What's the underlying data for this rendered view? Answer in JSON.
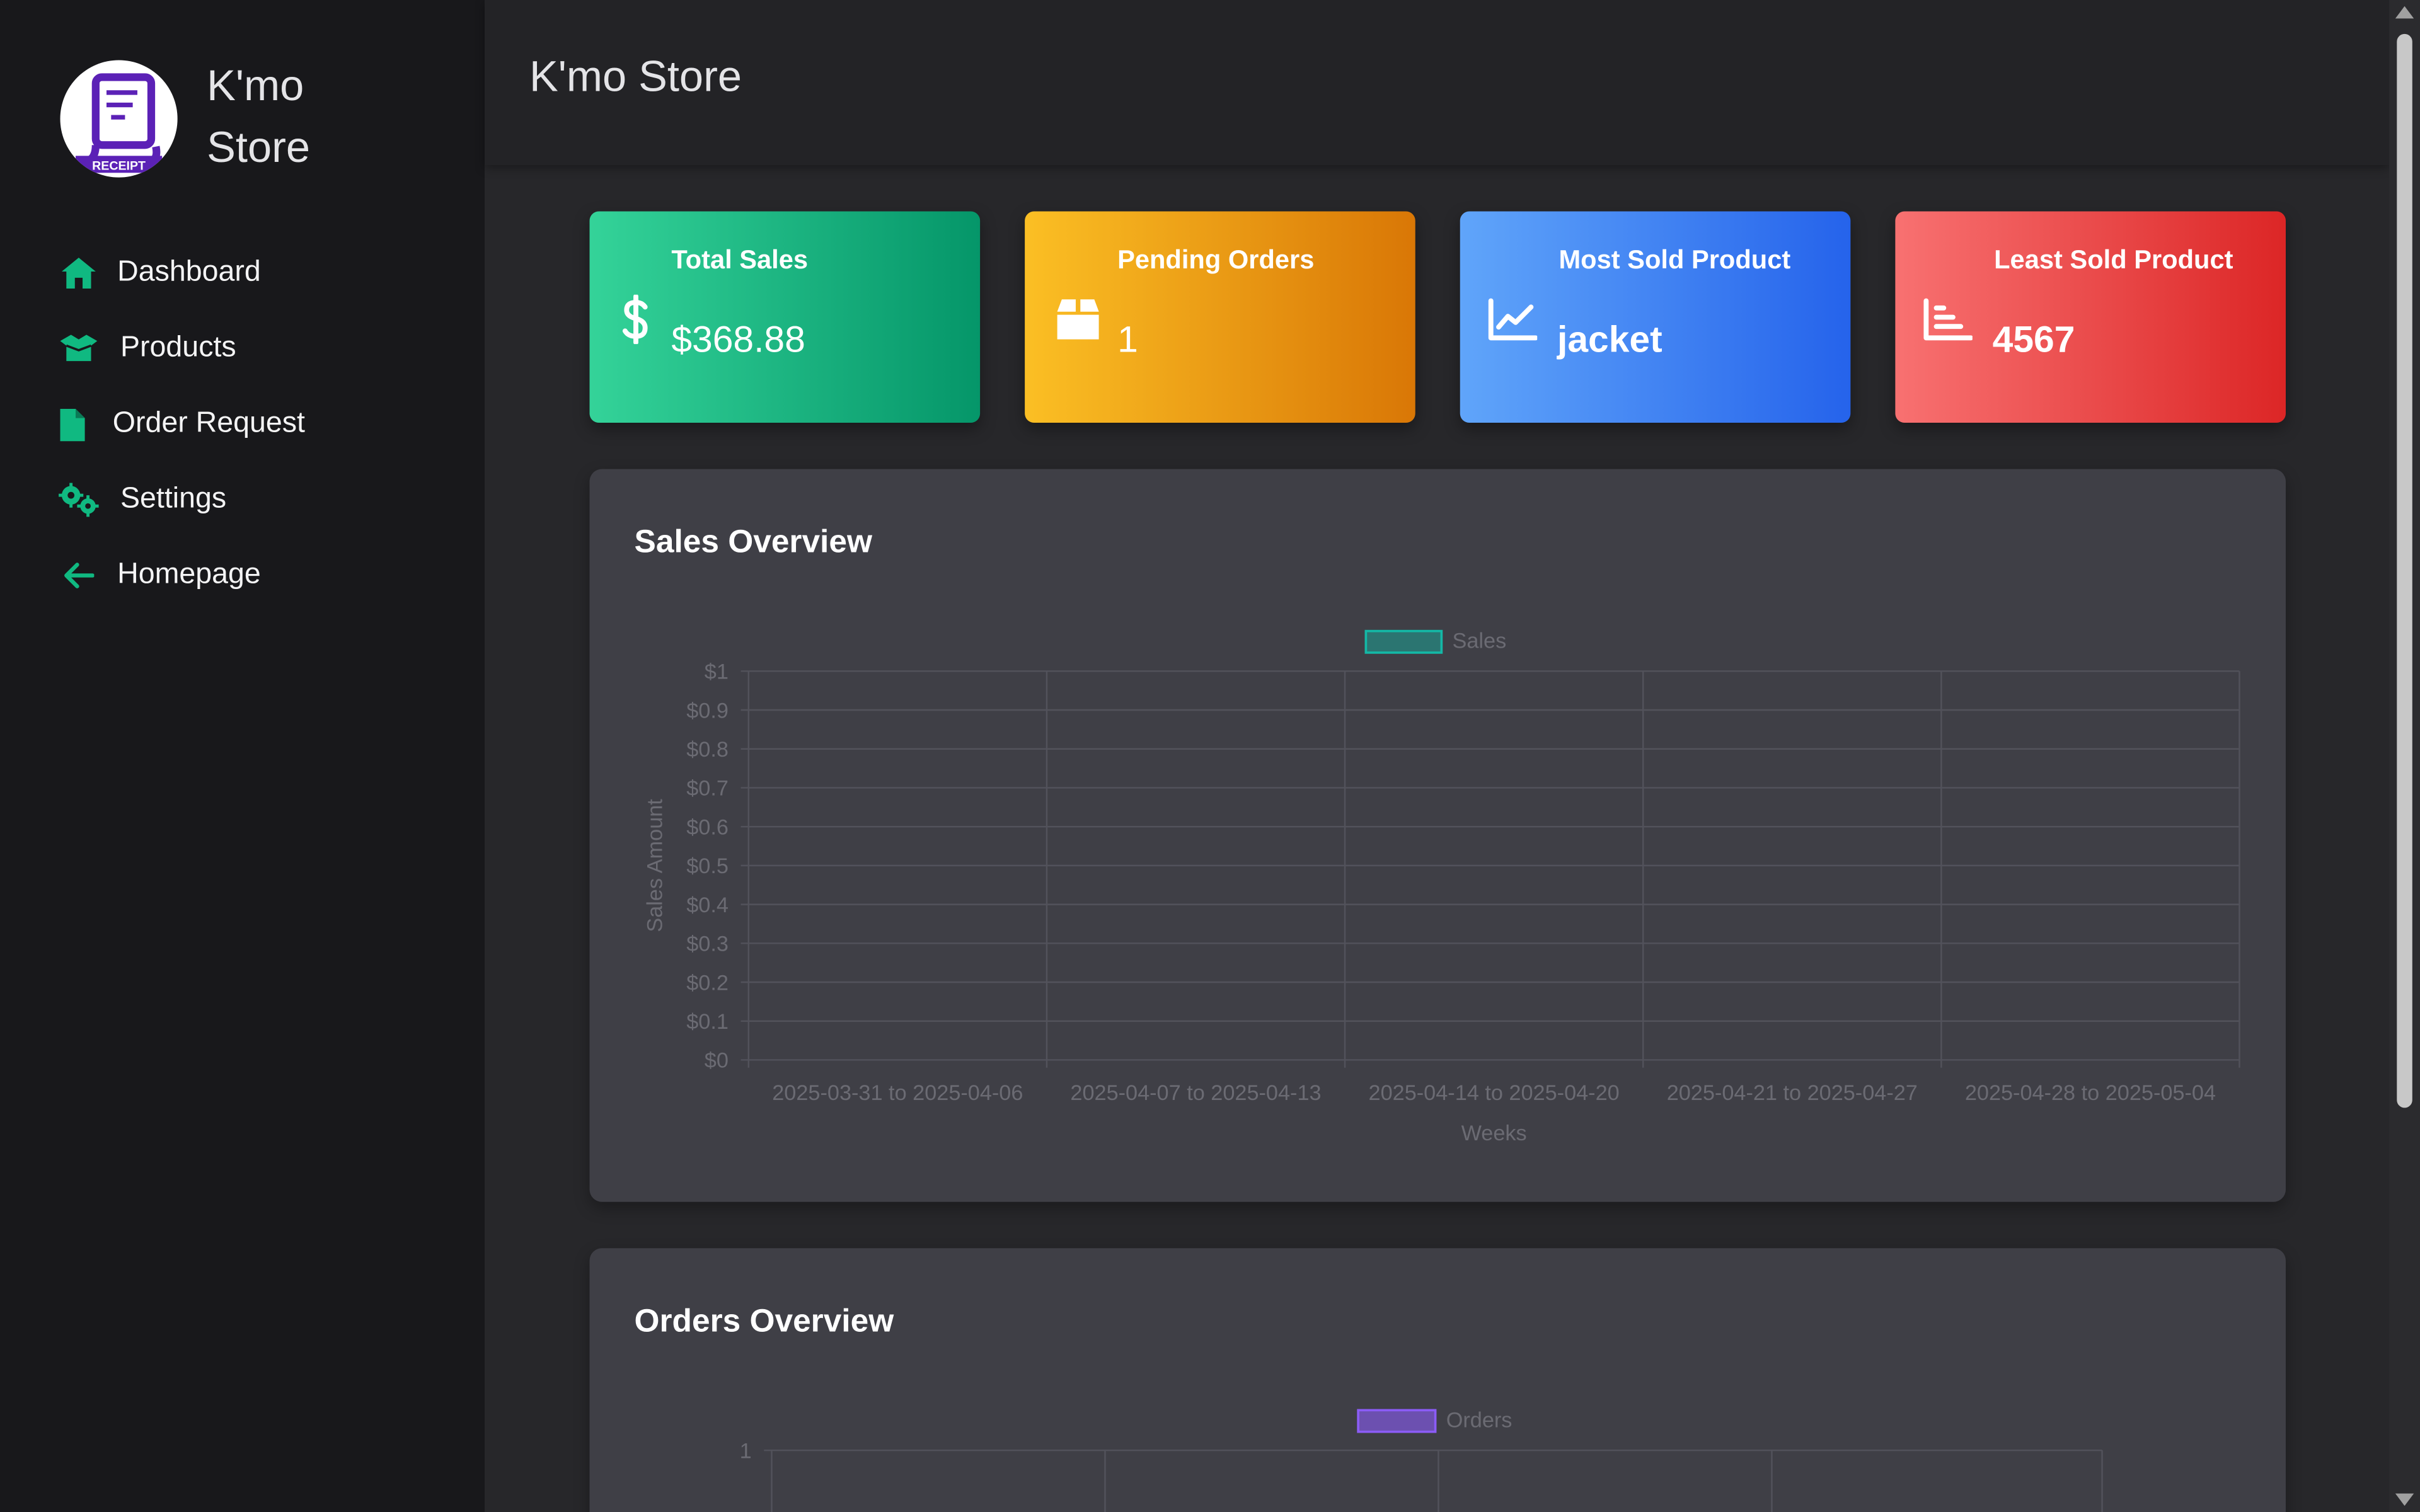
{
  "brand": {
    "name_line1": "K'mo",
    "name_line2": "Store",
    "logo_text": "RECEIPT"
  },
  "sidebar": {
    "items": [
      {
        "label": "Dashboard",
        "icon": "home-icon"
      },
      {
        "label": "Products",
        "icon": "box-open-icon"
      },
      {
        "label": "Order Request",
        "icon": "file-icon"
      },
      {
        "label": "Settings",
        "icon": "gears-icon"
      },
      {
        "label": "Homepage",
        "icon": "arrow-left-icon"
      }
    ]
  },
  "header": {
    "title": "K'mo Store"
  },
  "cards": [
    {
      "title": "Total Sales",
      "value": "$368.88",
      "icon": "dollar-icon",
      "color_from": "#34d399",
      "color_to": "#059669"
    },
    {
      "title": "Pending Orders",
      "value": "1",
      "icon": "box-icon",
      "color_from": "#fbbf24",
      "color_to": "#d97706"
    },
    {
      "title": "Most Sold Product",
      "value": "jacket",
      "icon": "chart-line-icon",
      "color_from": "#60a5fa",
      "color_to": "#2563eb"
    },
    {
      "title": "Least Sold Product",
      "value": "4567",
      "icon": "chart-bar-icon",
      "color_from": "#f87171",
      "color_to": "#dc2626"
    }
  ],
  "sales_panel": {
    "title": "Sales Overview"
  },
  "orders_panel": {
    "title": "Orders Overview"
  },
  "chart_data": [
    {
      "type": "bar",
      "title": "",
      "legend": "Sales",
      "legend_position": "top",
      "legend_color": "#14b8a6",
      "xlabel": "Weeks",
      "ylabel": "Sales Amount",
      "categories": [
        "2025-03-31 to 2025-04-06",
        "2025-04-07 to 2025-04-13",
        "2025-04-14 to 2025-04-20",
        "2025-04-21 to 2025-04-27",
        "2025-04-28 to 2025-05-04"
      ],
      "series": [
        {
          "name": "Sales",
          "values": [
            0,
            0,
            0,
            0,
            0
          ]
        }
      ],
      "yticks": [
        "$0",
        "$0.1",
        "$0.2",
        "$0.3",
        "$0.4",
        "$0.5",
        "$0.6",
        "$0.7",
        "$0.8",
        "$0.9",
        "$1"
      ],
      "ylim": [
        0,
        1
      ],
      "grid": true
    },
    {
      "type": "bar",
      "title": "",
      "legend": "Orders",
      "legend_position": "top",
      "legend_color": "#8b5cf6",
      "yticks_visible": [
        "1"
      ],
      "ylim": [
        0,
        1
      ],
      "grid": true
    }
  ]
}
